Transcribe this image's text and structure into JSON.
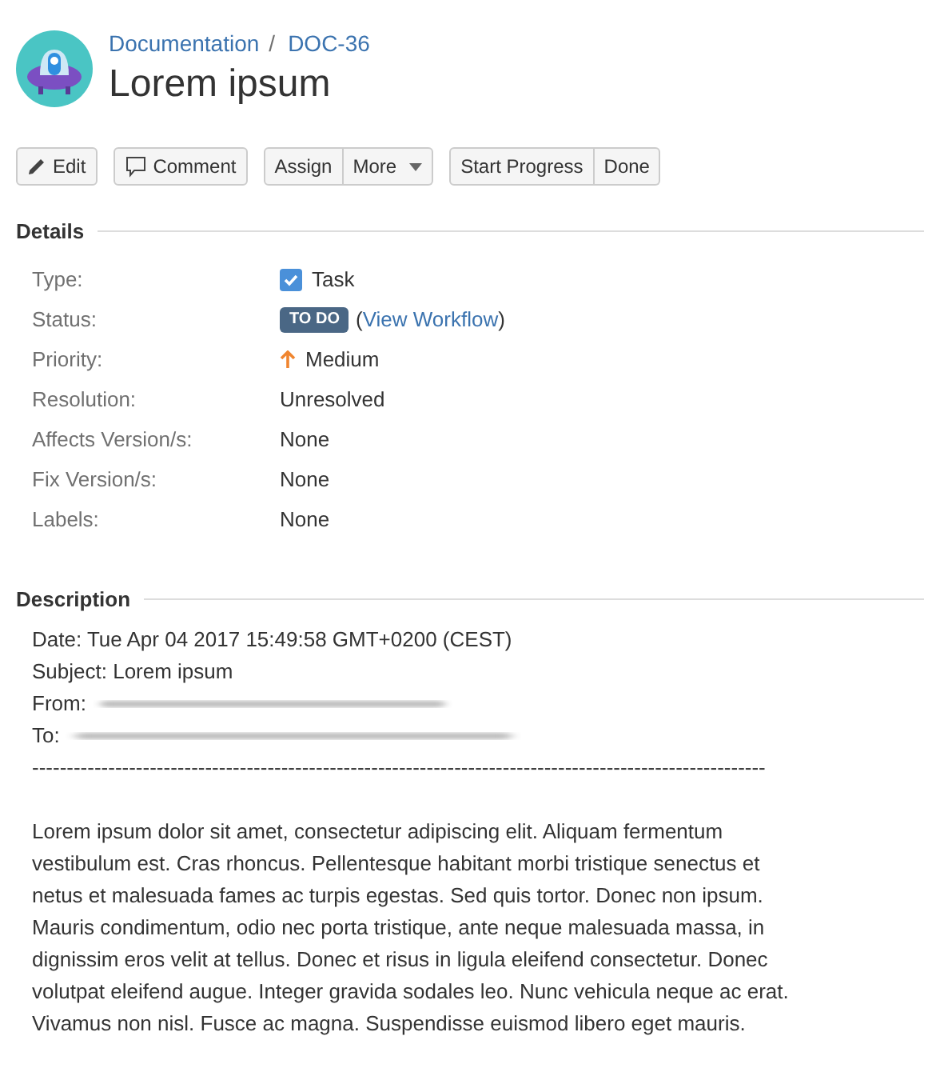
{
  "breadcrumbs": [
    {
      "label": "Documentation"
    },
    {
      "label": "DOC-36"
    }
  ],
  "breadcrumb_separator": "/",
  "title": "Lorem ipsum",
  "toolbar": [
    [
      {
        "label": "Edit",
        "kind": "edit",
        "dropdown": false
      }
    ],
    [
      {
        "label": "Comment",
        "kind": "comment",
        "dropdown": false
      }
    ],
    [
      {
        "label": "Assign",
        "kind": "plain",
        "dropdown": false
      },
      {
        "label": "More",
        "kind": "plain",
        "dropdown": true
      }
    ],
    [
      {
        "label": "Start Progress",
        "kind": "plain",
        "dropdown": false
      },
      {
        "label": "Done",
        "kind": "plain",
        "dropdown": false
      }
    ]
  ],
  "details": {
    "heading": "Details",
    "fields": [
      {
        "label": "Type:",
        "kind": "type",
        "value": "Task"
      },
      {
        "label": "Status:",
        "kind": "status",
        "badge": "TO DO",
        "link_open": "(",
        "link": "View Workflow",
        "link_close": ")"
      },
      {
        "label": "Priority:",
        "kind": "priority",
        "value": "Medium"
      },
      {
        "label": "Resolution:",
        "kind": "text",
        "value": "Unresolved"
      },
      {
        "label": "Affects Version/s:",
        "kind": "text",
        "value": "None"
      },
      {
        "label": "Fix Version/s:",
        "kind": "text",
        "value": "None"
      },
      {
        "label": "Labels:",
        "kind": "text",
        "value": "None"
      }
    ]
  },
  "description": {
    "heading": "Description",
    "header_lines": [
      {
        "text": "Date: Tue Apr 04 2017 15:49:58 GMT+0200 (CEST)",
        "redacted": false
      },
      {
        "text": "Subject: Lorem ipsum",
        "redacted": false
      },
      {
        "text": "From:",
        "redacted": true
      },
      {
        "text": "To:",
        "redacted": true
      }
    ],
    "separator": "----------------------------------------------------------------------------------------------------------",
    "body": "Lorem ipsum dolor sit amet, consectetur adipiscing elit. Aliquam fermentum vestibulum est. Cras rhoncus. Pellentesque habitant morbi tristique senectus et netus et malesuada fames ac turpis egestas. Sed quis tortor. Donec non ipsum. Mauris condimentum, odio nec porta tristique, ante neque malesuada massa, in dignissim eros velit at tellus. Donec et risus in ligula eleifend consectetur. Donec volutpat eleifend augue. Integer gravida sodales leo. Nunc vehicula neque ac erat. Vivamus non nisl. Fusce ac magna. Suspendisse euismod libero eget mauris."
  }
}
